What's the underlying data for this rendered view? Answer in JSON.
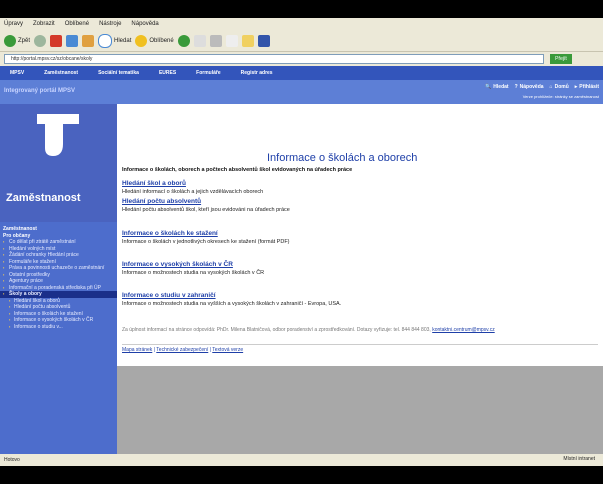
{
  "menu": [
    "Úpravy",
    "Zobrazit",
    "Oblíbené",
    "Nástroje",
    "Nápověda"
  ],
  "toolbar": {
    "back": "Zpět",
    "search": "Hledat",
    "favorites": "Oblíbené"
  },
  "address": {
    "url": "http://portal.mpsv.cz/sz/obcane/skoly",
    "go": "Přejít"
  },
  "nav": [
    "MPSV",
    "Zaměstnanost",
    "Sociální tematika",
    "EURES",
    "Formuláře",
    "Registr adres"
  ],
  "portal": {
    "title": "Integrovaný portál MPSV",
    "links": [
      "Hledat",
      "Nápověda",
      "Domů",
      "Přihlásit"
    ],
    "sub": "Verze prohlížeče: stránky se zaměstnanost"
  },
  "sidebar": {
    "section": "Zaměstnanost",
    "header1": "Zaměstnanost",
    "header2": "Pro občany",
    "items": [
      "Co dělat při ztrátě zaměstnání",
      "Hledání volných míst",
      "Žádání ochranky Hledání práce",
      "Formuláře ke stažení",
      "Práva a povinnosti uchazeče o zaměstnání",
      "Ostatní prostředky",
      "Agentury práce",
      "Informační a poradenská střediska při ÚP"
    ],
    "active": "Školy a obory",
    "subitems": [
      "Hledání škol a oborů",
      "Hledání počtu absolventů",
      "Informace o školách ke stažení",
      "Informace o vysokých školách v ČR",
      "Informace o studiu v..."
    ]
  },
  "main": {
    "title": "Informace o školách a oborech",
    "lead": "Informace o školách, oborech a počtech absolventů škol evidovaných na úřadech práce",
    "sections": [
      {
        "title": "Hledání škol a oborů",
        "desc": "Hledání informací o školách a jejich vzdělávacích oborech"
      },
      {
        "title": "Hledání počtu absolventů",
        "desc": "Hledání počtu absolventů škol, kteří jsou evidováni na úřadech práce"
      },
      {
        "title": "Informace o školách ke stažení",
        "desc": "Informace o školách v jednotlivých okresech ke stažení (formát PDF)"
      },
      {
        "title": "Informace o vysokých školách v ČR",
        "desc": "Informace o možnostech studia na vysokých školách v ČR"
      },
      {
        "title": "Informace o studiu v zahraničí",
        "desc": "Informace o možnostech studia na vyšších a vysokých školách v zahraničí - Evropa, USA."
      }
    ],
    "contact": "Za úplnost informací na stránce odpovídá: PhDr. Milena Blatničová, odbor poradenství a zprostředkování. Dotazy vyřizuje: tel. 844 844 803,",
    "contact_email": "kontaktni.centrum@mpsv.cz",
    "footer": [
      "Mapa stránek",
      "Technické zabezpečení",
      "Textová verze"
    ]
  },
  "status": {
    "left": "Hotovo",
    "zone": "Místní intranet"
  }
}
